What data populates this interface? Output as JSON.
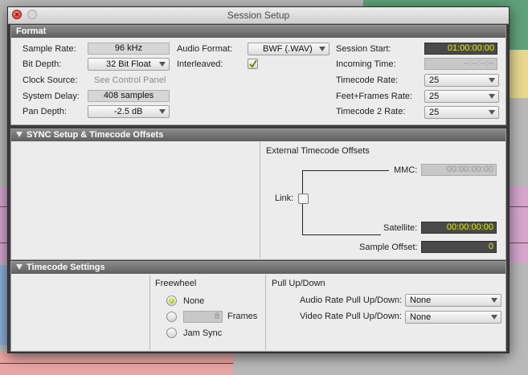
{
  "window": {
    "title": "Session Setup"
  },
  "format": {
    "header": "Format",
    "sample_rate": {
      "label": "Sample Rate:",
      "value": "96 kHz"
    },
    "bit_depth": {
      "label": "Bit Depth:",
      "value": "32 Bit Float"
    },
    "clock_source": {
      "label": "Clock Source:",
      "value": "See Control Panel"
    },
    "system_delay": {
      "label": "System Delay:",
      "value": "408 samples"
    },
    "pan_depth": {
      "label": "Pan Depth:",
      "value": "-2.5 dB"
    },
    "audio_format": {
      "label": "Audio Format:",
      "value": "BWF (.WAV)"
    },
    "interleaved": {
      "label": "Interleaved:",
      "checked": true
    },
    "session_start": {
      "label": "Session Start:",
      "value": "01:00:00:00"
    },
    "incoming_time": {
      "label": "Incoming Time:",
      "value": "--:--:--:--"
    },
    "timecode_rate": {
      "label": "Timecode Rate:",
      "value": "25"
    },
    "feet_frames_rate": {
      "label": "Feet+Frames Rate:",
      "value": "25"
    },
    "timecode2_rate": {
      "label": "Timecode 2 Rate:",
      "value": "25"
    }
  },
  "sync": {
    "header": "SYNC Setup & Timecode Offsets",
    "ext_title": "External Timecode Offsets",
    "mmc": {
      "label": "MMC:",
      "value": "00:00:00:00"
    },
    "link": {
      "label": "Link:",
      "checked": false
    },
    "satellite": {
      "label": "Satellite:",
      "value": "00:00:00:00"
    },
    "sample_offset": {
      "label": "Sample Offset:",
      "value": "0"
    }
  },
  "timecode_settings": {
    "header": "Timecode Settings",
    "freewheel": {
      "title": "Freewheel",
      "none_label": "None",
      "frames_value": "8",
      "frames_label": "Frames",
      "jam_sync_label": "Jam Sync",
      "selected": "None"
    },
    "pullup": {
      "title": "Pull Up/Down",
      "audio": {
        "label": "Audio Rate Pull Up/Down:",
        "value": "None"
      },
      "video": {
        "label": "Video Rate Pull Up/Down:",
        "value": "None"
      }
    }
  },
  "colors": {
    "timecode_text": "#e2f000",
    "panel_bg": "#ececec",
    "header_bg": "#6f6f6f"
  }
}
